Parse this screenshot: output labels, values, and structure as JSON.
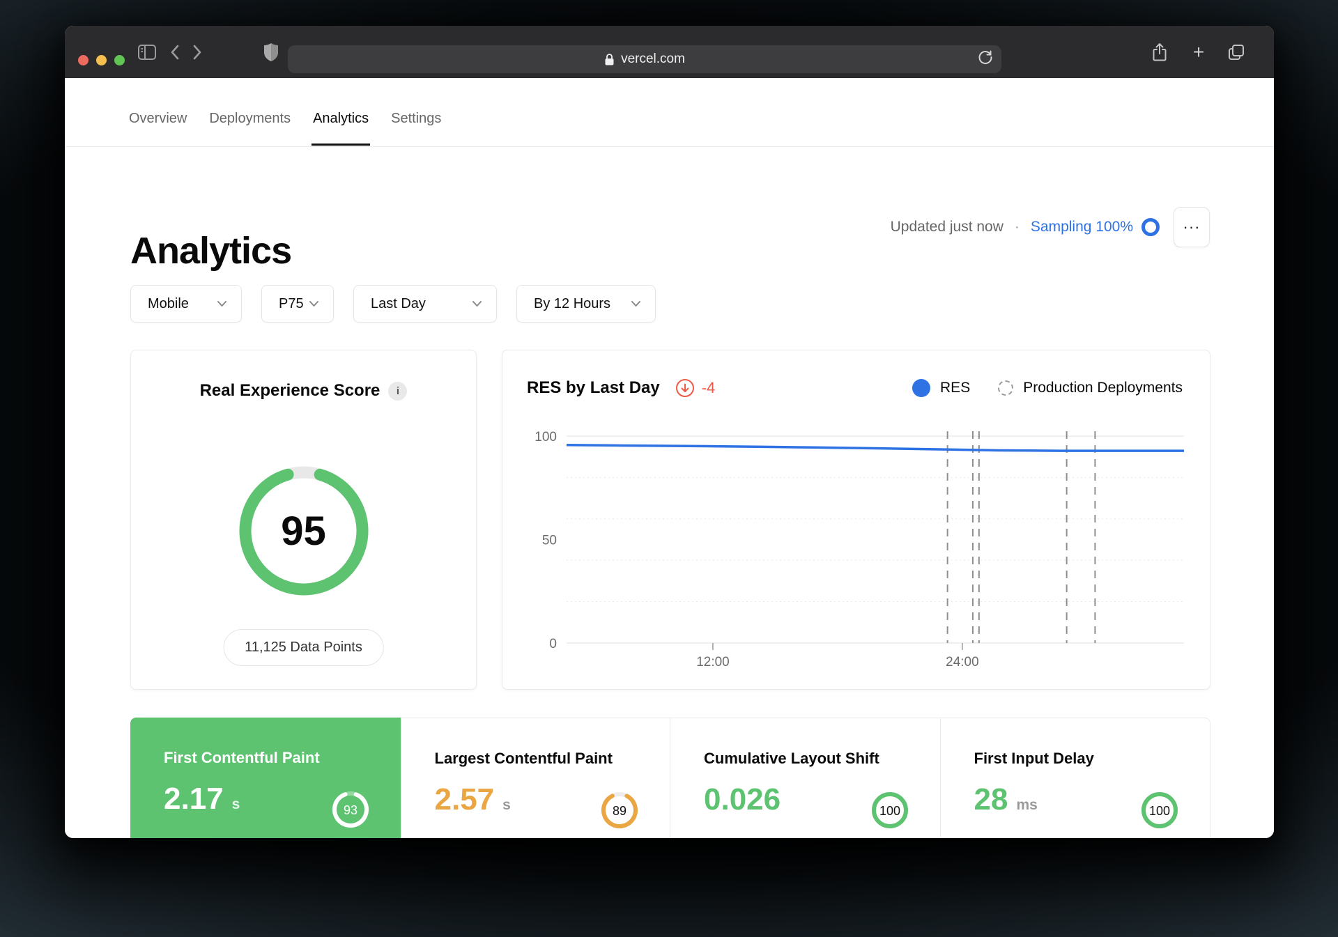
{
  "browser": {
    "url": "vercel.com",
    "plus_glyph": "+"
  },
  "nav_tabs": [
    {
      "label": "Overview",
      "active": false
    },
    {
      "label": "Deployments",
      "active": false
    },
    {
      "label": "Analytics",
      "active": true
    },
    {
      "label": "Settings",
      "active": false
    }
  ],
  "header": {
    "title": "Analytics",
    "updated": "Updated just now",
    "separator": "·",
    "sampling": "Sampling 100%",
    "more_dots": "···"
  },
  "filters": [
    {
      "label": "Mobile"
    },
    {
      "label": "P75"
    },
    {
      "label": "Last Day"
    },
    {
      "label": "By 12 Hours"
    }
  ],
  "res_score": {
    "title": "Real Experience Score",
    "info_glyph": "i",
    "score": "95",
    "data_points": "11,125 Data Points"
  },
  "res_chart": {
    "title": "RES by Last Day",
    "delta": "-4",
    "legend_res": "RES",
    "legend_prod": "Production Deployments"
  },
  "metrics": [
    {
      "title": "First Contentful Paint",
      "value": "2.17",
      "unit": "s",
      "score": "93"
    },
    {
      "title": "Largest Contentful Paint",
      "value": "2.57",
      "unit": "s",
      "score": "89"
    },
    {
      "title": "Cumulative Layout Shift",
      "value": "0.026",
      "unit": "",
      "score": "100"
    },
    {
      "title": "First Input Delay",
      "value": "28",
      "unit": "ms",
      "score": "100"
    }
  ],
  "colors": {
    "green": "#5dc370",
    "orange": "#e9a642",
    "blue": "#2e72e4",
    "red": "#ee5a46"
  },
  "chart_data": {
    "type": "line",
    "title": "RES by Last Day",
    "xlabel": "",
    "ylabel": "RES",
    "ylim": [
      0,
      100
    ],
    "grid": "horizontal every 20, on",
    "legend_position": "top-right",
    "legend": [
      "RES",
      "Production Deployments"
    ],
    "yticks": [
      {
        "label": "100",
        "v": 100
      },
      {
        "label": "50",
        "v": 50
      },
      {
        "label": "0",
        "v": 0
      }
    ],
    "gridlines_v": [
      100,
      80,
      60,
      40,
      20,
      0
    ],
    "xticks": [
      {
        "label": "12:00",
        "t": 0.237
      },
      {
        "label": "24:00",
        "t": 0.641
      }
    ],
    "series": [
      {
        "name": "RES",
        "color": "#2e72e4",
        "points": [
          {
            "t": 0.0,
            "v": 95.7
          },
          {
            "t": 0.08,
            "v": 95.5
          },
          {
            "t": 0.16,
            "v": 95.3
          },
          {
            "t": 0.24,
            "v": 95.1
          },
          {
            "t": 0.32,
            "v": 94.8
          },
          {
            "t": 0.4,
            "v": 94.5
          },
          {
            "t": 0.48,
            "v": 94.2
          },
          {
            "t": 0.56,
            "v": 93.8
          },
          {
            "t": 0.62,
            "v": 93.5
          },
          {
            "t": 0.66,
            "v": 93.3
          },
          {
            "t": 0.7,
            "v": 93.1
          },
          {
            "t": 0.75,
            "v": 93.0
          },
          {
            "t": 0.8,
            "v": 92.9
          },
          {
            "t": 0.9,
            "v": 92.9
          },
          {
            "t": 1.0,
            "v": 92.9
          }
        ]
      }
    ],
    "production_deployments_t": [
      0.617,
      0.658,
      0.668,
      0.81,
      0.856
    ]
  }
}
